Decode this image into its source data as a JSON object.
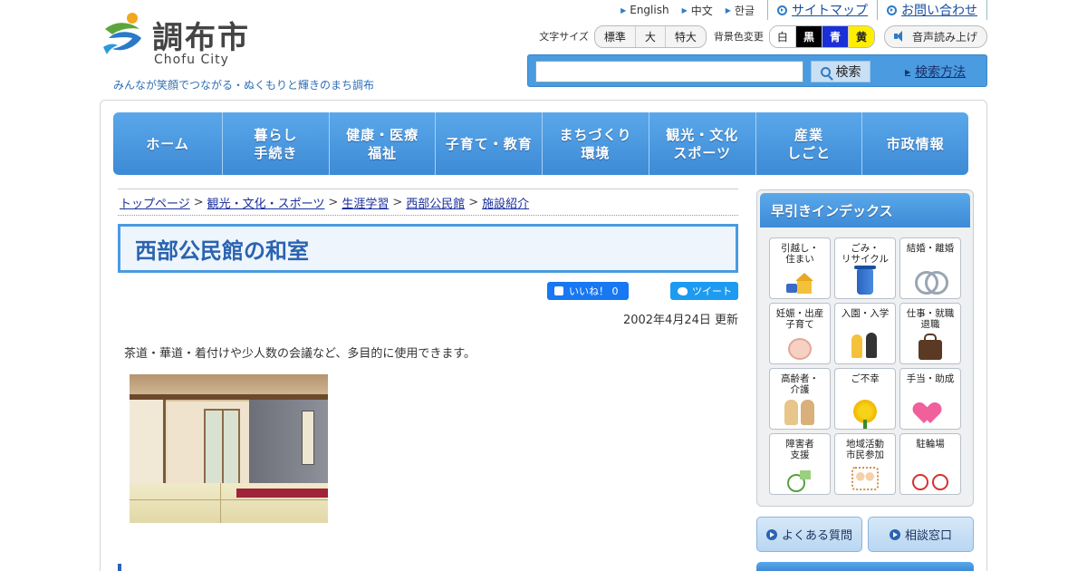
{
  "header": {
    "logo_title": "調布市",
    "logo_sub": "Chofu City",
    "tagline": "みんなが笑顔でつながる・ぬくもりと輝きのまち調布",
    "lang_links": [
      "English",
      "中文",
      "한글"
    ],
    "sitemap_label": "サイトマップ",
    "contact_label": "お問い合わせ",
    "font_size_label": "文字サイズ",
    "font_sizes": [
      "標準",
      "大",
      "特大"
    ],
    "bg_color_label": "背景色変更",
    "bg_colors": [
      "白",
      "黒",
      "青",
      "黄"
    ],
    "voice_label": "音声読み上げ",
    "search_placeholder": "",
    "search_button": "検索",
    "search_how": "検索方法"
  },
  "global_nav": [
    "ホーム",
    "暮らし\n手続き",
    "健康・医療\n福祉",
    "子育て・教育",
    "まちづくり\n環境",
    "観光・文化\nスポーツ",
    "産業\nしごと",
    "市政情報"
  ],
  "breadcrumb": [
    "トップページ",
    "観光・文化・スポーツ",
    "生涯学習",
    "西部公民館",
    "施設紹介"
  ],
  "breadcrumb_sep": ">",
  "page": {
    "title": "西部公民館の和室",
    "like_label": "いいね！ 0",
    "tweet_label": "ツイート",
    "updated": "2002年4月24日 更新",
    "body": "茶道・華道・着付けや少人数の会議など、多目的に使用できます。"
  },
  "sidebar": {
    "index_title": "早引きインデックス",
    "tiles": [
      {
        "label": "引越し・\n住まい",
        "icon": "house-icon"
      },
      {
        "label": "ごみ・\nリサイクル",
        "icon": "trash-bin-icon"
      },
      {
        "label": "結婚・離婚",
        "icon": "rings-icon"
      },
      {
        "label": "妊娠・出産\n子育て",
        "icon": "baby-icon"
      },
      {
        "label": "入園・入学",
        "icon": "children-icon"
      },
      {
        "label": "仕事・就職\n退職",
        "icon": "bag-icon"
      },
      {
        "label": "高齢者・\n介護",
        "icon": "elderly-icon"
      },
      {
        "label": "ご不幸",
        "icon": "chrysanthemum-icon"
      },
      {
        "label": "手当・助成",
        "icon": "heart-hands-icon"
      },
      {
        "label": "障害者\n支援",
        "icon": "wheelchair-icon"
      },
      {
        "label": "地域活動\n市民参加",
        "icon": "community-icon"
      },
      {
        "label": "駐輪場",
        "icon": "bicycle-icon"
      }
    ],
    "faq_label": "よくある質問",
    "consult_label": "相談窓口"
  },
  "colors": {
    "accent": "#3d8ad6",
    "title_text": "#2a63b0",
    "link": "#1a2f9a"
  }
}
